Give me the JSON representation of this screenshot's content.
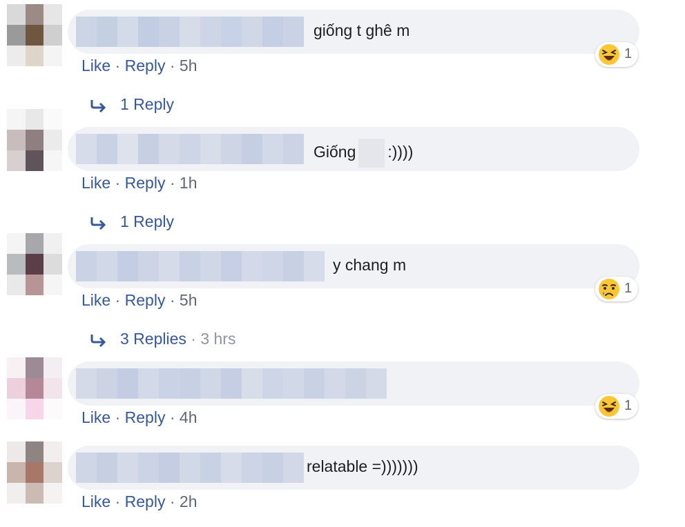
{
  "comments": [
    {
      "text": "giống t ghê m",
      "actions": {
        "like": "Like",
        "reply": "Reply",
        "sep": "·",
        "time": "5h"
      },
      "reaction": {
        "icon": "laughing-emoji-icon",
        "count": "1"
      },
      "replies": {
        "label": "1 Reply",
        "meta": ""
      }
    },
    {
      "text_before": "Giống",
      "text_after": ":))))",
      "actions": {
        "like": "Like",
        "reply": "Reply",
        "sep": "·",
        "time": "1h"
      },
      "replies": {
        "label": "1 Reply",
        "meta": ""
      }
    },
    {
      "text": "y chang m",
      "actions": {
        "like": "Like",
        "reply": "Reply",
        "sep": "·",
        "time": "5h"
      },
      "reaction": {
        "icon": "sad-crying-emoji-icon",
        "count": "1"
      },
      "replies": {
        "label": "3 Replies",
        "meta": "· 3 hrs"
      }
    },
    {
      "text": "",
      "actions": {
        "like": "Like",
        "reply": "Reply",
        "sep": "·",
        "time": "4h"
      },
      "reaction": {
        "icon": "laughing-emoji-icon",
        "count": "1"
      }
    },
    {
      "text": "relatable =)))))))",
      "actions": {
        "like": "Like",
        "reply": "Reply",
        "sep": "·",
        "time": "2h"
      }
    }
  ],
  "colors": {
    "link": "#385898",
    "bubble": "#f0f2f5",
    "meta": "#90949c",
    "emoji": "#fcc736"
  }
}
